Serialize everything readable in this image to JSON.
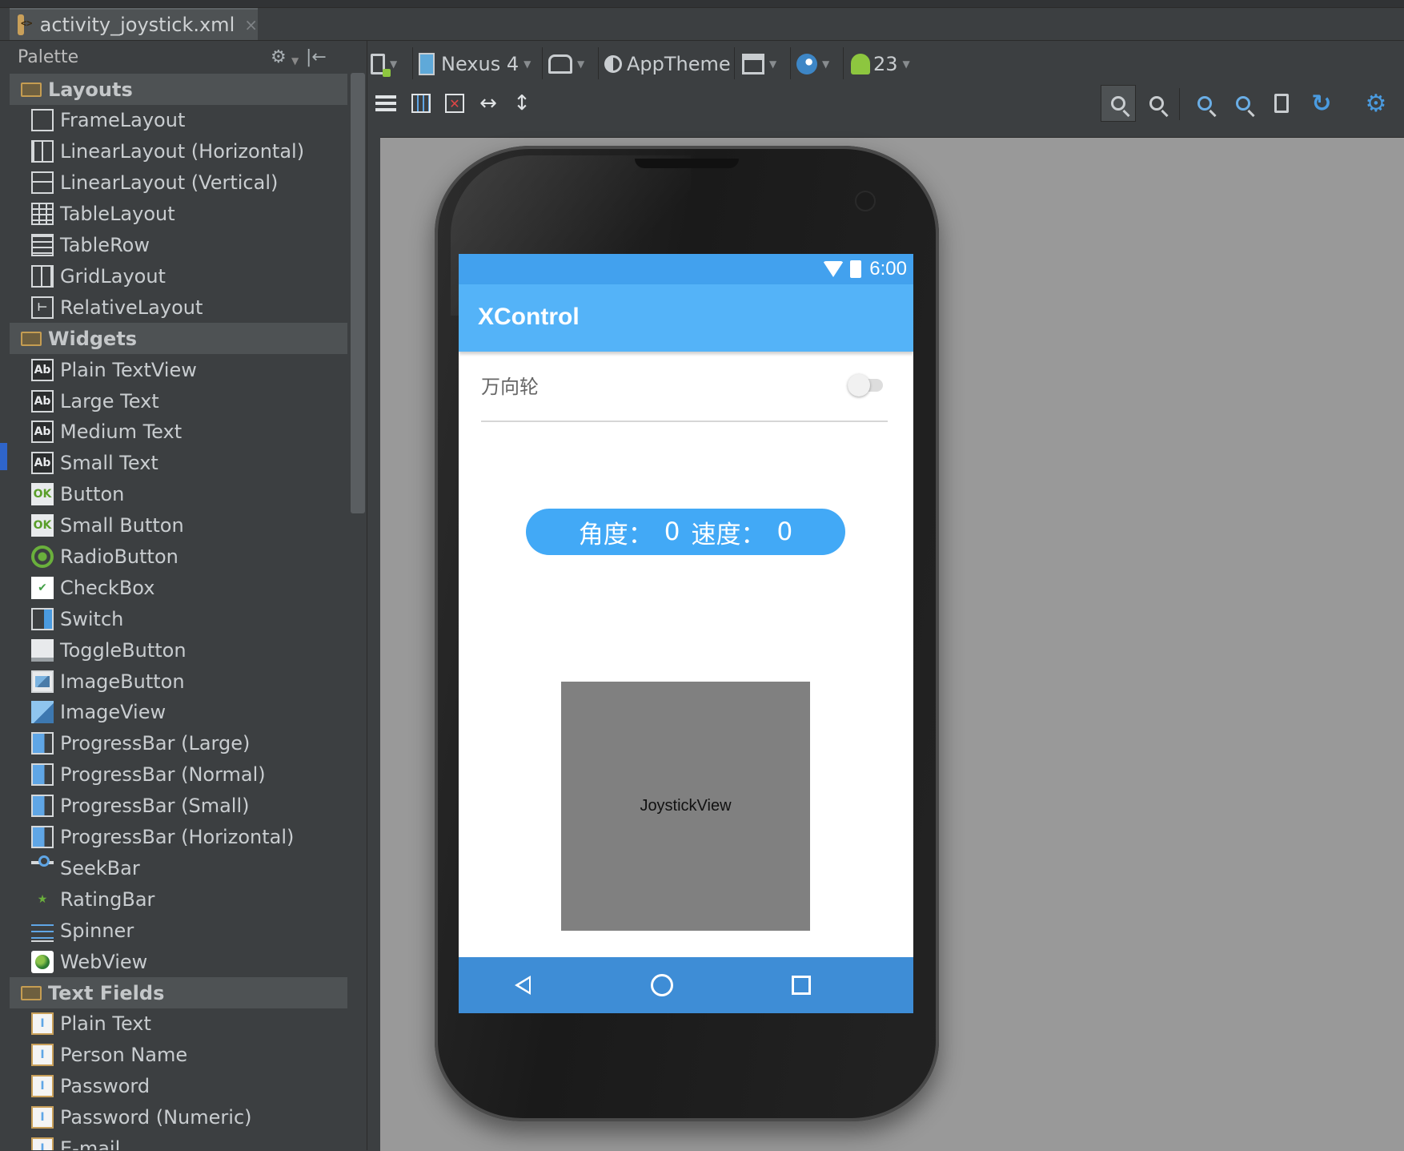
{
  "file_tab": {
    "name": "activity_joystick.xml",
    "close": "×",
    "icon": "xml-file-icon"
  },
  "palette": {
    "title": "Palette",
    "categories": [
      {
        "name": "Layouts",
        "items": [
          "FrameLayout",
          "LinearLayout (Horizontal)",
          "LinearLayout (Vertical)",
          "TableLayout",
          "TableRow",
          "GridLayout",
          "RelativeLayout"
        ]
      },
      {
        "name": "Widgets",
        "items": [
          "Plain TextView",
          "Large Text",
          "Medium Text",
          "Small Text",
          "Button",
          "Small Button",
          "RadioButton",
          "CheckBox",
          "Switch",
          "ToggleButton",
          "ImageButton",
          "ImageView",
          "ProgressBar (Large)",
          "ProgressBar (Normal)",
          "ProgressBar (Small)",
          "ProgressBar (Horizontal)",
          "SeekBar",
          "RatingBar",
          "Spinner",
          "WebView"
        ]
      },
      {
        "name": "Text Fields",
        "items": [
          "Plain Text",
          "Person Name",
          "Password",
          "Password (Numeric)",
          "E-mail"
        ]
      }
    ]
  },
  "toolbar": {
    "device": "Nexus 4",
    "theme": "AppTheme",
    "api": "23",
    "icons": [
      "device-config-icon",
      "orientation-icon",
      "activity-icon",
      "locale-icon",
      "android-icon"
    ]
  },
  "toolbar2": {
    "icons": [
      "layout-vertical-icon",
      "layout-horizontal-icon",
      "remove-layout-icon",
      "width-icon",
      "height-icon",
      "zoom-fit-icon",
      "zoom-actual-icon",
      "zoom-in-icon",
      "zoom-out-icon",
      "preview-icon",
      "refresh-icon",
      "settings-icon"
    ]
  },
  "device_preview": {
    "status_time": "6:00",
    "app_title": "XControl",
    "switch_label": "万向轮",
    "switch_on": false,
    "angle_label": "角度：",
    "angle_value": "0",
    "speed_label": "速度：",
    "speed_value": "0",
    "joystick_label": "JoystickView"
  }
}
